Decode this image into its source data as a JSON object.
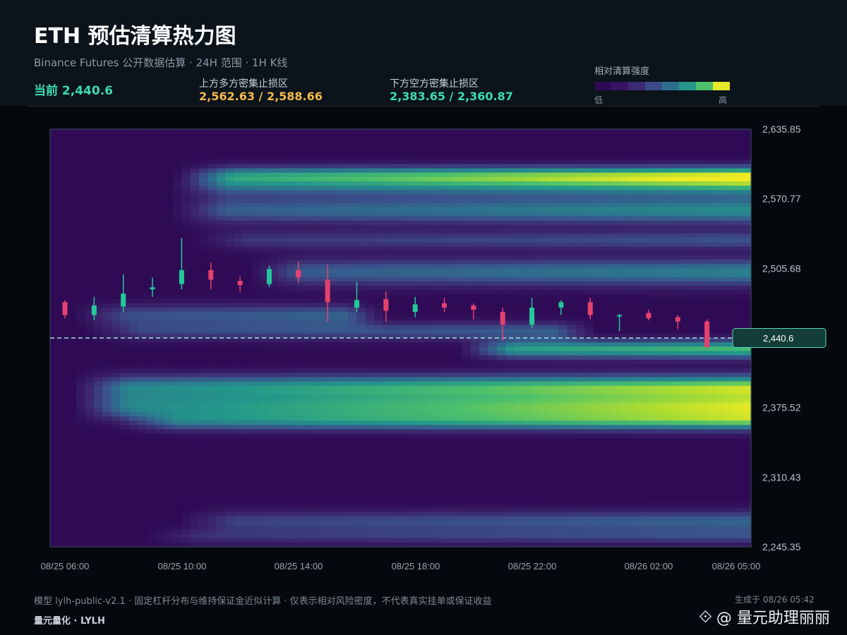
{
  "header": {
    "title": "ETH 预估清算热力图",
    "subtitle": "Binance Futures 公开数据估算 · 24H 范围 · 1H K线",
    "current_label": "当前 2,440.6",
    "upper_zone_label": "上方多方密集止损区",
    "upper_zone_value": "2,562.63 / 2,588.66",
    "lower_zone_label": "下方空方密集止损区",
    "lower_zone_value": "2,383.65 / 2,360.87"
  },
  "legend": {
    "title": "相对清算强度",
    "low": "低",
    "high": "高",
    "colors": [
      "#2f0a55",
      "#38135f",
      "#3b2a73",
      "#3b4a87",
      "#2e6f8e",
      "#26958a",
      "#4dbf6c",
      "#e7ea2a"
    ]
  },
  "chart_data": {
    "type": "heatmap",
    "y_ticks": [
      "2,635.85",
      "2,570.77",
      "2,505.68",
      "2,440.6",
      "2,375.52",
      "2,310.43",
      "2,245.35"
    ],
    "ylim": [
      2245.35,
      2635.85
    ],
    "x_ticks": [
      "08/25 06:00",
      "08/25 10:00",
      "08/25 14:00",
      "08/25 18:00",
      "08/25 22:00",
      "08/26 02:00",
      "08/26 05:00"
    ],
    "current_price": 2440.6,
    "current_price_label": "2,440.6",
    "candles": [
      {
        "o": 2474,
        "c": 2462,
        "h": 2476,
        "l": 2459
      },
      {
        "o": 2462,
        "c": 2471,
        "h": 2479,
        "l": 2457
      },
      {
        "o": 2470,
        "c": 2482,
        "h": 2500,
        "l": 2465
      },
      {
        "o": 2486,
        "c": 2488,
        "h": 2497,
        "l": 2479
      },
      {
        "o": 2491,
        "c": 2504,
        "h": 2534,
        "l": 2486
      },
      {
        "o": 2504,
        "c": 2495,
        "h": 2511,
        "l": 2486
      },
      {
        "o": 2494,
        "c": 2490,
        "h": 2498,
        "l": 2484
      },
      {
        "o": 2491,
        "c": 2505,
        "h": 2508,
        "l": 2488
      },
      {
        "o": 2504,
        "c": 2497,
        "h": 2512,
        "l": 2492
      },
      {
        "o": 2495,
        "c": 2474,
        "h": 2509,
        "l": 2456
      },
      {
        "o": 2469,
        "c": 2476,
        "h": 2493,
        "l": 2465
      },
      {
        "o": 2477,
        "c": 2466,
        "h": 2484,
        "l": 2456
      },
      {
        "o": 2465,
        "c": 2472,
        "h": 2479,
        "l": 2460
      },
      {
        "o": 2473,
        "c": 2469,
        "h": 2478,
        "l": 2465
      },
      {
        "o": 2471,
        "c": 2467,
        "h": 2473,
        "l": 2458
      },
      {
        "o": 2465,
        "c": 2453,
        "h": 2469,
        "l": 2438
      },
      {
        "o": 2453,
        "c": 2469,
        "h": 2478,
        "l": 2450
      },
      {
        "o": 2469,
        "c": 2474,
        "h": 2476,
        "l": 2462
      },
      {
        "o": 2474,
        "c": 2462,
        "h": 2478,
        "l": 2458
      },
      {
        "o": 2462,
        "c": 2462,
        "h": 2463,
        "l": 2447
      },
      {
        "o": 2464,
        "c": 2459,
        "h": 2467,
        "l": 2457
      },
      {
        "o": 2460,
        "c": 2456,
        "h": 2462,
        "l": 2449
      },
      {
        "o": 2456,
        "c": 2432,
        "h": 2458,
        "l": 2431
      },
      {
        "o": 2432,
        "c": 2432,
        "h": 2432,
        "l": 2426
      }
    ],
    "bands": [
      {
        "center": 2593,
        "strength": 0.78,
        "width": 6,
        "start": 0.18
      },
      {
        "center": 2583,
        "strength": 0.62,
        "width": 7,
        "start": 0.17
      },
      {
        "center": 2560,
        "strength": 0.6,
        "width": 9,
        "start": 0.17
      },
      {
        "center": 2532,
        "strength": 0.35,
        "width": 6,
        "start": 0.2
      },
      {
        "center": 2502,
        "strength": 0.55,
        "width": 9,
        "start": 0.28
      },
      {
        "center": 2462,
        "strength": 0.55,
        "width": 7,
        "start": 0.03,
        "end": 0.42
      },
      {
        "center": 2447,
        "strength": 0.45,
        "width": 6,
        "start": 0.05,
        "end": 0.72
      },
      {
        "center": 2430,
        "strength": 0.78,
        "width": 6,
        "start": 0.58
      },
      {
        "center": 2395,
        "strength": 0.85,
        "width": 8,
        "start": 0.03
      },
      {
        "center": 2376,
        "strength": 0.9,
        "width": 9,
        "start": 0.03
      },
      {
        "center": 2362,
        "strength": 0.6,
        "width": 6,
        "start": 0.1
      },
      {
        "center": 2269,
        "strength": 0.42,
        "width": 7,
        "start": 0.18
      },
      {
        "center": 2255,
        "strength": 0.3,
        "width": 5,
        "start": 0.13
      }
    ]
  },
  "footer": {
    "note": "模型 lylh-public-v2.1 · 固定杠杆分布与维持保证金近似计算 · 仅表示相对风险密度，不代表真实挂单或保证收益",
    "generated": "生成于 08/26 05:42",
    "brand": "量元量化 · LYLH",
    "watermark": "@ 量元助理丽丽"
  },
  "colors": {
    "up": "#23c99a",
    "down": "#e5416f",
    "current": "#3ddbb0",
    "upper_zone": "#f5b94b",
    "lower_zone": "#3ddbb0"
  }
}
